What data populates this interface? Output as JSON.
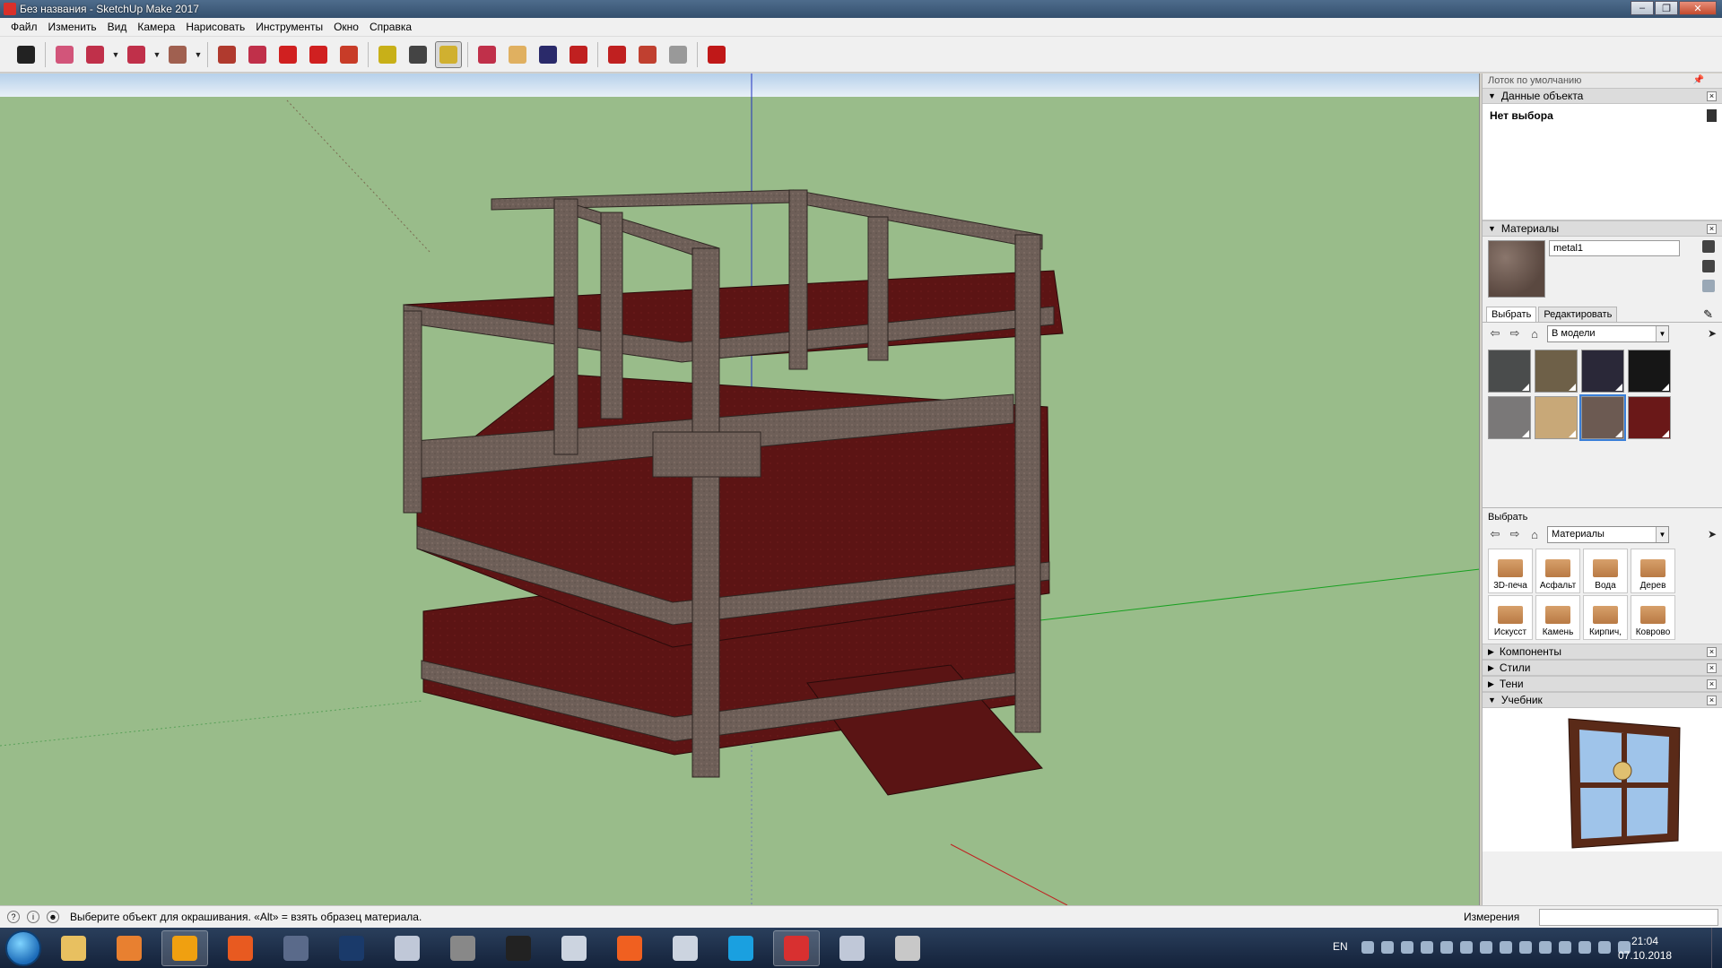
{
  "window": {
    "title": "Без названия - SketchUp Make 2017"
  },
  "menu": [
    "Файл",
    "Изменить",
    "Вид",
    "Камера",
    "Нарисовать",
    "Инструменты",
    "Окно",
    "Справка"
  ],
  "toolbar": {
    "tools": [
      {
        "name": "select-tool-button",
        "color": "#222222"
      },
      {
        "name": "eraser-tool-button",
        "color": "#d2557a"
      },
      {
        "name": "line-tool-button",
        "color": "#c0304a",
        "dropdown": true
      },
      {
        "name": "arc-tool-button",
        "color": "#c0304a",
        "dropdown": true
      },
      {
        "name": "rectangle-tool-button",
        "color": "#a06050",
        "dropdown": true
      },
      {
        "name": "push-pull-tool-button",
        "color": "#b03a2e"
      },
      {
        "name": "offset-tool-button",
        "color": "#c0304a"
      },
      {
        "name": "move-tool-button",
        "color": "#d02020"
      },
      {
        "name": "rotate-tool-button",
        "color": "#d02020"
      },
      {
        "name": "scale-tool-button",
        "color": "#c83c28"
      },
      {
        "name": "tape-measure-tool-button",
        "color": "#c8b018"
      },
      {
        "name": "text-tool-button",
        "color": "#444444"
      },
      {
        "name": "paint-bucket-tool-button",
        "color": "#d0b030",
        "active": true
      },
      {
        "name": "orbit-tool-button",
        "color": "#c0304a"
      },
      {
        "name": "pan-tool-button",
        "color": "#e0b060"
      },
      {
        "name": "zoom-tool-button",
        "color": "#2a2a6a"
      },
      {
        "name": "zoom-extents-tool-button",
        "color": "#c02020"
      },
      {
        "name": "warehouse-button",
        "color": "#c02020"
      },
      {
        "name": "extension-warehouse-button",
        "color": "#c04030"
      },
      {
        "name": "share-model-button",
        "color": "#999999"
      },
      {
        "name": "ruby-console-button",
        "color": "#c01818"
      }
    ]
  },
  "tray": {
    "title": "Лоток по умолчанию",
    "entity_info": {
      "header": "Данные объекта",
      "status": "Нет выбора"
    },
    "materials": {
      "header": "Материалы",
      "name": "metal1",
      "tabs": [
        "Выбрать",
        "Редактировать"
      ],
      "collection": "В модели",
      "swatches": [
        {
          "color": "#4a4c4c"
        },
        {
          "color": "#6e6048"
        },
        {
          "color": "#2a2838"
        },
        {
          "color": "#161616"
        },
        {
          "color": "#7a7878"
        },
        {
          "color": "#c8a878"
        },
        {
          "color": "#6c5a52",
          "selected": true
        },
        {
          "color": "#6a1818"
        }
      ],
      "library_label": "Выбрать",
      "library_collection": "Материалы",
      "library": [
        "3D-печа",
        "Асфальт",
        "Вода",
        "Дерев",
        "Искусст",
        "Камень",
        "Кирпич,",
        "Коврово"
      ]
    },
    "collapsed_panels": [
      "Компоненты",
      "Стили",
      "Тени"
    ],
    "tutorial": {
      "header": "Учебник"
    }
  },
  "status": {
    "message": "Выберите объект для окрашивания. «Alt» = взять образец материала.",
    "measurements_label": "Измерения"
  },
  "taskbar": {
    "lang": "EN",
    "time": "21:04",
    "date": "07.10.2018",
    "apps": [
      {
        "name": "explorer-task",
        "color": "#e8c060"
      },
      {
        "name": "media-player-task",
        "color": "#e88030"
      },
      {
        "name": "origin-task",
        "color": "#f0a010",
        "active": true
      },
      {
        "name": "origin-alt-task",
        "color": "#e85a20"
      },
      {
        "name": "app-task",
        "color": "#5a6a8a"
      },
      {
        "name": "photoshop-task",
        "color": "#1a3a6a"
      },
      {
        "name": "window-task",
        "color": "#c0c8d8"
      },
      {
        "name": "bird-app-task",
        "color": "#888888"
      },
      {
        "name": "gta-task",
        "color": "#222222"
      },
      {
        "name": "game-task",
        "color": "#ccd4e0"
      },
      {
        "name": "dots-app-task",
        "color": "#f06020"
      },
      {
        "name": "game2-task",
        "color": "#ccd4e0"
      },
      {
        "name": "skype-task",
        "color": "#1aa0e0"
      },
      {
        "name": "sketchup-task",
        "color": "#d83030",
        "active": true
      },
      {
        "name": "window2-task",
        "color": "#c0c8d8"
      },
      {
        "name": "paint-task",
        "color": "#c8c8c8"
      }
    ]
  }
}
